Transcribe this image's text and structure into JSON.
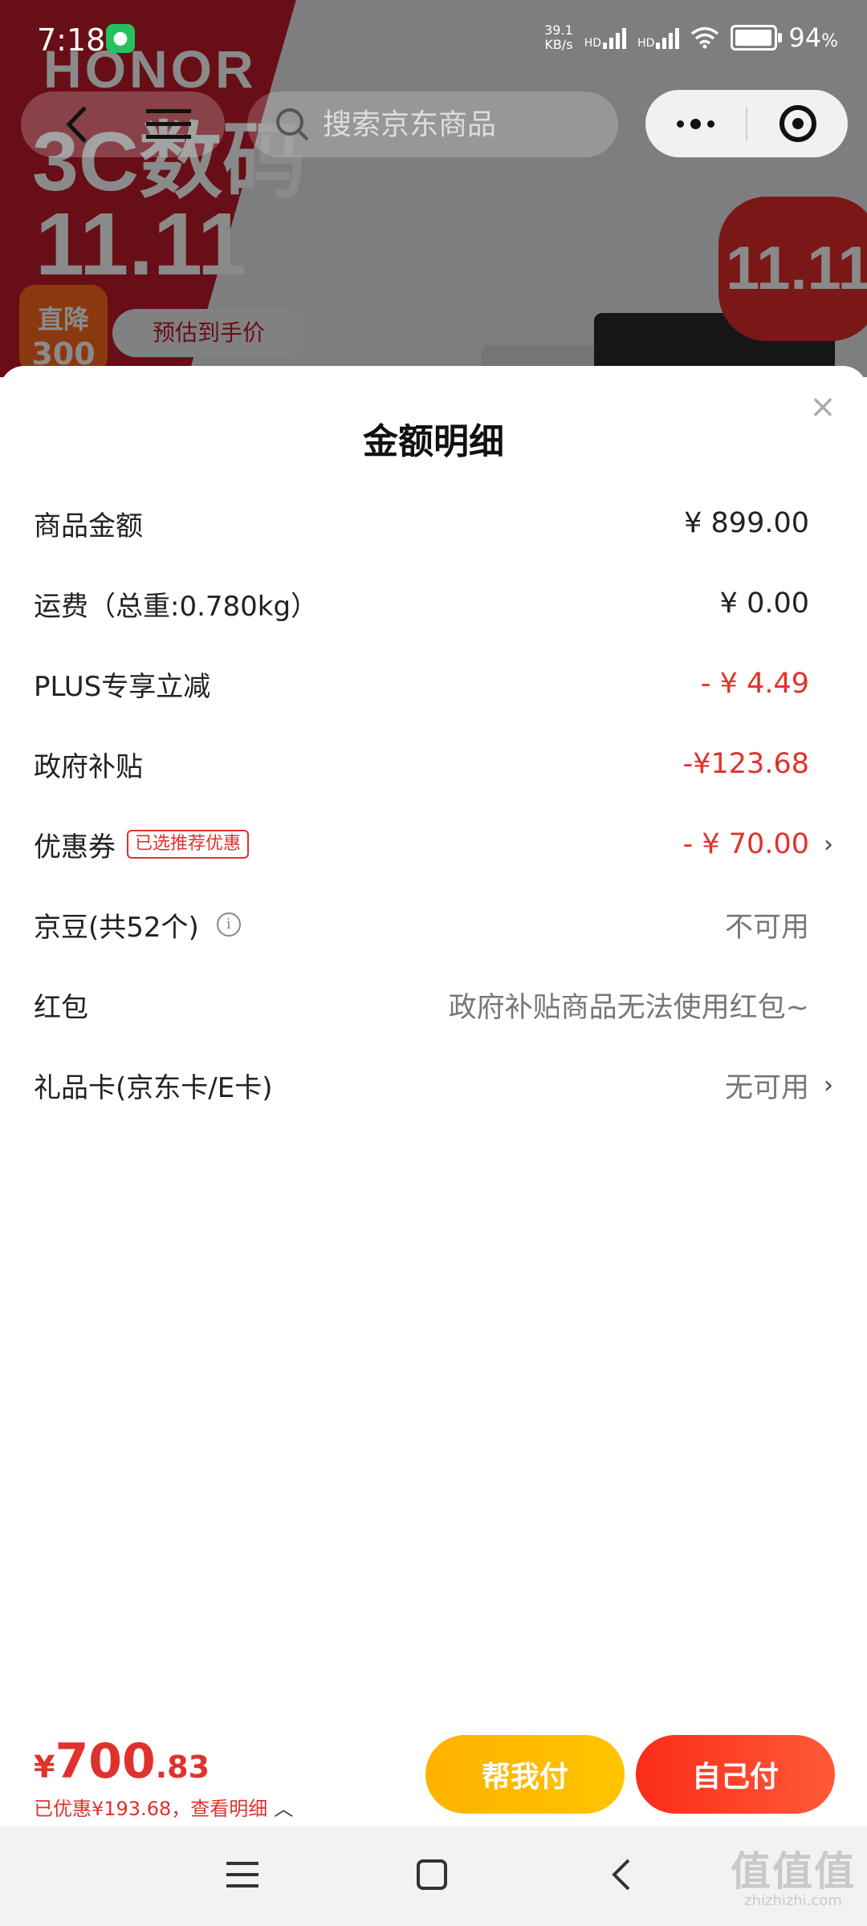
{
  "status_bar": {
    "time": "7:18",
    "net_speed_value": "39.1",
    "net_speed_unit": "KB/s",
    "sim1_label": "HD",
    "sim2_label": "HD",
    "battery_percent": "94",
    "battery_unit": "%"
  },
  "banner": {
    "brand": "HONOR",
    "title_line1": "3C数码",
    "title_line2": "11.11",
    "discount_line1": "直降",
    "discount_line2": "300",
    "pill_text": "预估到手价",
    "badge": "11.11"
  },
  "nav": {
    "search_placeholder": "搜索京东商品"
  },
  "modal": {
    "title": "金额明细",
    "close": "×",
    "rows": [
      {
        "label": "商品金额",
        "value": "¥ 899.00"
      },
      {
        "label": "运费（总重:0.780kg）",
        "value": "¥ 0.00"
      },
      {
        "label": "PLUS专享立减",
        "value": "- ¥ 4.49"
      },
      {
        "label": "政府补贴",
        "value": "-¥123.68"
      },
      {
        "label": "优惠券",
        "tag": "已选推荐优惠",
        "value": "- ¥ 70.00",
        "chevron": "›"
      },
      {
        "label": "京豆(共52个)",
        "info": "i",
        "value": "不可用"
      },
      {
        "label": "红包",
        "value": "政府补贴商品无法使用红包~"
      },
      {
        "label": "礼品卡(京东卡/E卡)",
        "value": "无可用",
        "chevron": "›"
      }
    ]
  },
  "bottom_bar": {
    "currency": "¥",
    "total_int": "700",
    "total_dec": ".83",
    "saved_text": "已优惠¥193.68，查看明细",
    "saved_caret": "︿",
    "help_pay": "帮我付",
    "self_pay": "自己付"
  },
  "watermark": {
    "logo": "值值值",
    "domain": "zhizhizhi.com"
  },
  "colors": {
    "accent_red": "#e0322d",
    "help_button": "#ffb200",
    "self_button": "#fa2c19"
  }
}
